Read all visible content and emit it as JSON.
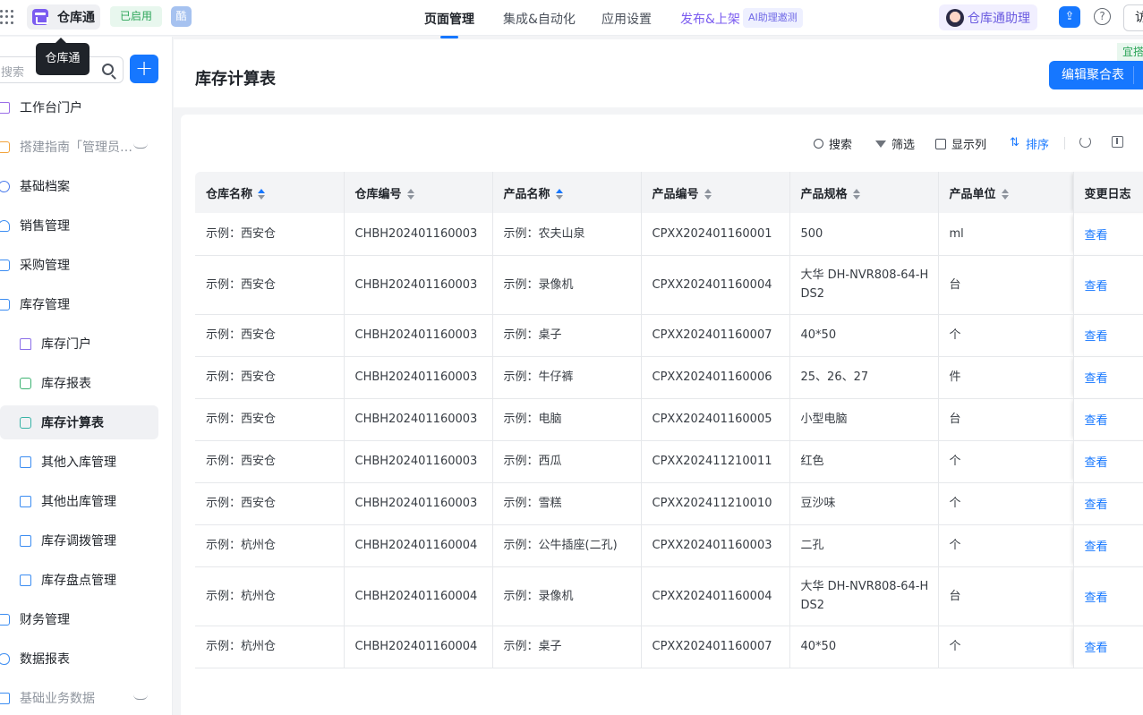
{
  "topbar": {
    "app_name": "仓库通",
    "status": "已启用",
    "ku_badge": "酷",
    "tabs": [
      {
        "label": "页面管理",
        "active": true
      },
      {
        "label": "集成&自动化",
        "active": false
      },
      {
        "label": "应用设置",
        "active": false
      }
    ],
    "publish": "发布&上架",
    "ai_invite": "AI助理邀测",
    "assistant": "仓库通助理",
    "help": "?",
    "visit": "访"
  },
  "sidebar": {
    "search_placeholder": "搜索",
    "tooltip": "仓库通",
    "add": "+",
    "items": [
      {
        "label": "工作台门户",
        "icon": "portal-icon"
      },
      {
        "label": "搭建指南「管理员…",
        "icon": "guide-icon"
      },
      {
        "label": "基础档案",
        "icon": "cube-icon"
      },
      {
        "label": "销售管理",
        "icon": "people-icon"
      },
      {
        "label": "采购管理",
        "icon": "cart-icon"
      },
      {
        "label": "库存管理",
        "icon": "stock-icon"
      },
      {
        "label": "库存门户",
        "icon": "home-icon"
      },
      {
        "label": "库存报表",
        "icon": "report-icon"
      },
      {
        "label": "库存计算表",
        "icon": "calc-icon"
      },
      {
        "label": "其他入库管理",
        "icon": "form-icon"
      },
      {
        "label": "其他出库管理",
        "icon": "form-icon"
      },
      {
        "label": "库存调拨管理",
        "icon": "form-icon"
      },
      {
        "label": "库存盘点管理",
        "icon": "form-icon"
      },
      {
        "label": "财务管理",
        "icon": "finance-icon"
      },
      {
        "label": "数据报表",
        "icon": "database-icon"
      },
      {
        "label": "基础业务数据",
        "icon": "folder-icon"
      }
    ]
  },
  "page": {
    "title": "库存计算表",
    "edit_button": "编辑聚合表",
    "preview_tag": "宜搭"
  },
  "toolbar": {
    "search": "搜索",
    "filter": "筛选",
    "columns": "显示列",
    "sort": "排序"
  },
  "table": {
    "headers": [
      "仓库名称",
      "仓库编号",
      "产品名称",
      "产品编号",
      "产品规格",
      "产品单位",
      "变更日志"
    ],
    "rows": [
      [
        "示例：西安仓",
        "CHBH202401160003",
        "示例：农夫山泉",
        "CPXX202401160001",
        "500",
        "ml",
        "查看"
      ],
      [
        "示例：西安仓",
        "CHBH202401160003",
        "示例：录像机",
        "CPXX202401160004",
        "大华 DH-NVR808-64-HDS2",
        "台",
        "查看"
      ],
      [
        "示例：西安仓",
        "CHBH202401160003",
        "示例：桌子",
        "CPXX202401160007",
        "40*50",
        "个",
        "查看"
      ],
      [
        "示例：西安仓",
        "CHBH202401160003",
        "示例：牛仔裤",
        "CPXX202401160006",
        "25、26、27",
        "件",
        "查看"
      ],
      [
        "示例：西安仓",
        "CHBH202401160003",
        "示例：电脑",
        "CPXX202401160005",
        "小型电脑",
        "台",
        "查看"
      ],
      [
        "示例：西安仓",
        "CHBH202401160003",
        "示例：西瓜",
        "CPXX202411210011",
        "红色",
        "个",
        "查看"
      ],
      [
        "示例：西安仓",
        "CHBH202401160003",
        "示例：雪糕",
        "CPXX202411210010",
        "豆沙味",
        "个",
        "查看"
      ],
      [
        "示例：杭州仓",
        "CHBH202401160004",
        "示例：公牛插座(二孔)",
        "CPXX202401160003",
        "二孔",
        "个",
        "查看"
      ],
      [
        "示例：杭州仓",
        "CHBH202401160004",
        "示例：录像机",
        "CPXX202401160004",
        "大华 DH-NVR808-64-HDS2",
        "台",
        "查看"
      ],
      [
        "示例：杭州仓",
        "CHBH202401160004",
        "示例：桌子",
        "CPXX202401160007",
        "40*50",
        "个",
        "查看"
      ]
    ]
  },
  "colors": {
    "accent": "#1677ff",
    "success": "#2ea65a",
    "purple": "#7b5cf0"
  }
}
